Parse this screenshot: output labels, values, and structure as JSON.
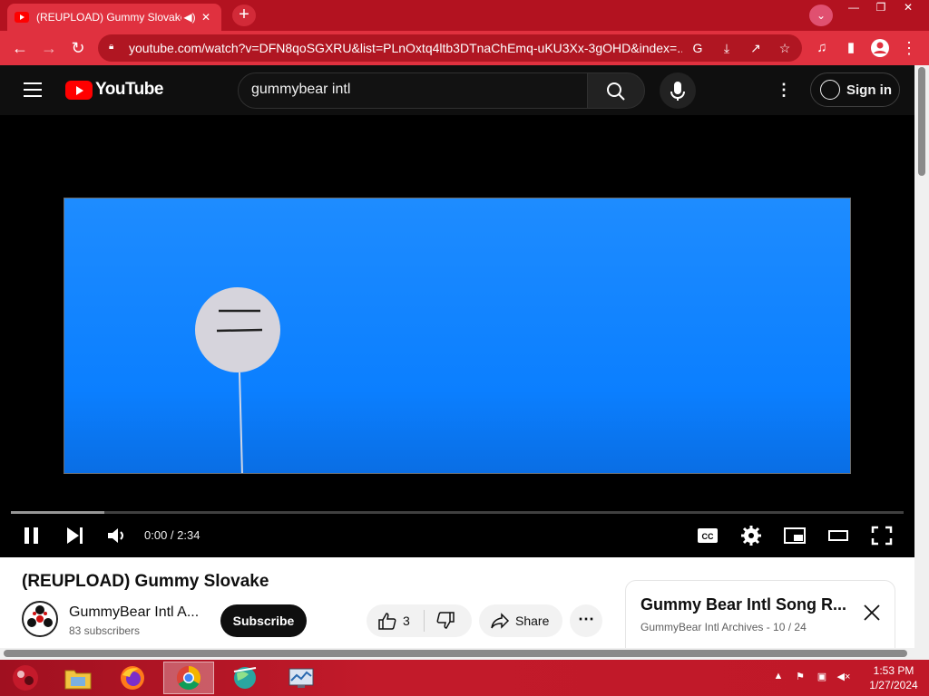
{
  "browser": {
    "tab_title": "(REUPLOAD) Gummy Slovake",
    "url": "youtube.com/watch?v=DFN8qoSGXRU&list=PLnOxtq4ltb3DTnaChEmq-uKU3Xx-3gOHD&index=..."
  },
  "masthead": {
    "logo_text": "YouTube",
    "search_value": "gummybear intl",
    "search_placeholder": "Search",
    "signin_label": "Sign in"
  },
  "player": {
    "time_display": "0:00 / 2:34",
    "loaded_fraction": 0.105
  },
  "video": {
    "title": "(REUPLOAD) Gummy Slovake",
    "channel_name": "GummyBear Intl A...",
    "subscribers": "83 subscribers",
    "subscribe_label": "Subscribe",
    "like_count": "3",
    "share_label": "Share"
  },
  "playlist": {
    "title": "Gummy Bear Intl Song R...",
    "meta": "GummyBear Intl Archives - 10 / 24"
  },
  "taskbar": {
    "time": "1:53 PM",
    "date": "1/27/2024"
  },
  "colors": {
    "chrome_tabstrip": "#b31220",
    "chrome_toolbar": "#e0313f",
    "youtube_red": "#ff0000",
    "video_blue": "#0b7fff",
    "masthead_bg": "#0f0f0f"
  }
}
